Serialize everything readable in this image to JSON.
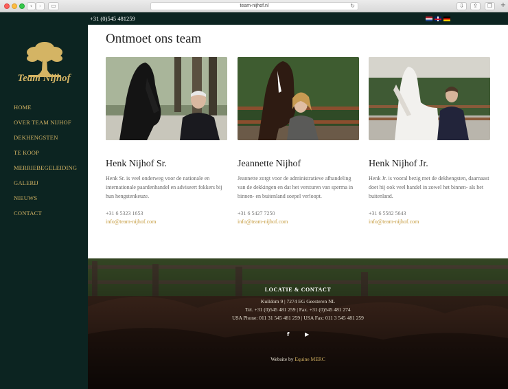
{
  "browser": {
    "url": "team-nijhof.nl"
  },
  "topbar": {
    "phone": "+31 (0)545 481259"
  },
  "sidebar": {
    "logo_text": "Team Nijhof",
    "items": [
      {
        "label": "HOME"
      },
      {
        "label": "OVER TEAM NIJHOF"
      },
      {
        "label": "DEKHENGSTEN"
      },
      {
        "label": "TE KOOP"
      },
      {
        "label": "MERRIEBEGELEIDING"
      },
      {
        "label": "GALERIJ"
      },
      {
        "label": "NIEUWS"
      },
      {
        "label": "CONTACT"
      }
    ]
  },
  "main": {
    "title": "Ontmoet ons team",
    "members": [
      {
        "name": "Henk Nijhof Sr.",
        "description": "Henk Sr. is veel onderweg voor de nationale en internationale paardenhandel en adviseert fokkers bij hun hengstenkeuze.",
        "phone": "+31 6 5323 1653",
        "email": "info@team-nijhof.com"
      },
      {
        "name": "Jeannette Nijhof",
        "description": "Jeannette zorgt voor de administratieve afhandeling van de dekkingen en dat het versturen van sperma in binnen- en buitenland soepel verloopt.",
        "phone": "+31 6 5427 7250",
        "email": "info@team-nijhof.com"
      },
      {
        "name": "Henk Nijhof Jr.",
        "description": "Henk Jr. is vooral bezig met de dekhengsten, daarnaast doet hij ook veel handel in zowel het binnen- als het buitenland.",
        "phone": "+31 6 5582 5643",
        "email": "info@team-nijhof.com"
      }
    ]
  },
  "footer": {
    "heading": "LOCATIE & CONTACT",
    "address": "Kuildom 9 | 7274 EG Geesteren NL",
    "tel_fax": "Tel. +31 (0)545 481 259 | Fax. +31 (0)545 481 274",
    "usa": "USA Phone: 011 31 545 481 259 | USA Fax: 011 3 545 481 259",
    "social": {
      "facebook": "f",
      "youtube": "▶"
    },
    "credit_prefix": "Website by ",
    "credit_link": "Equine MERC"
  },
  "colors": {
    "sidebar_bg": "#0c2421",
    "gold_accent": "#d4b464",
    "link": "#c49a3c"
  }
}
